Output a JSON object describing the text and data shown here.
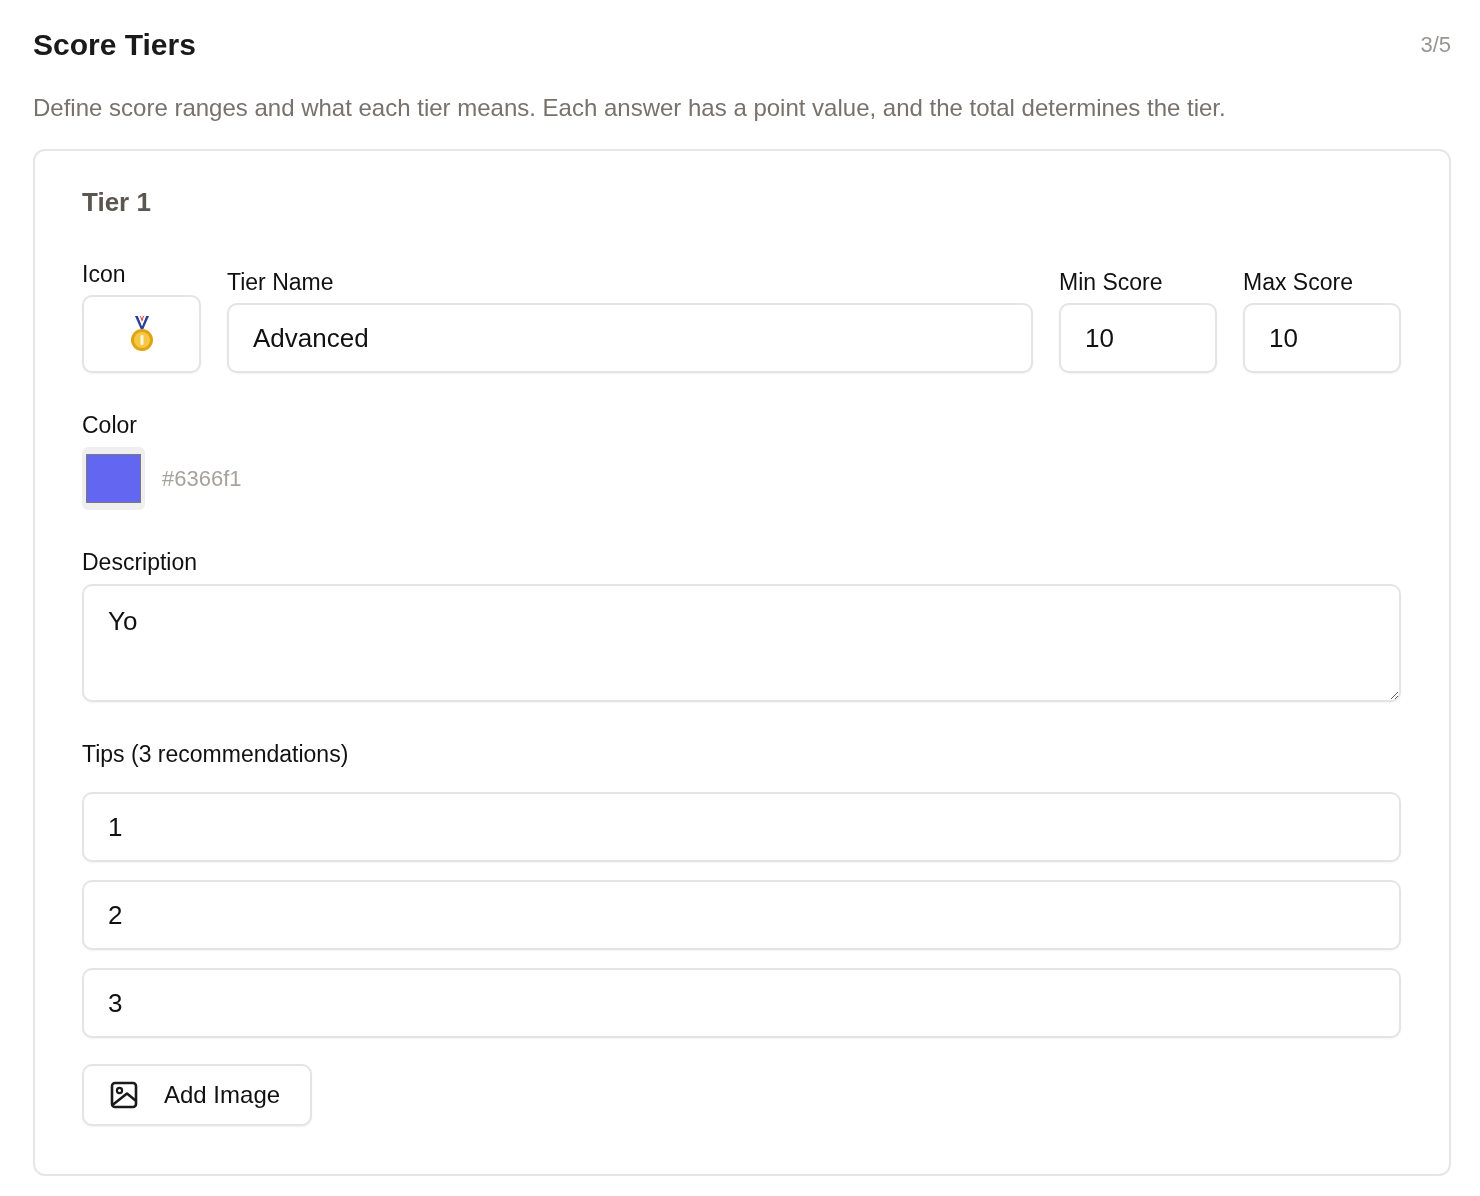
{
  "header": {
    "title": "Score Tiers",
    "step": "3/5",
    "description": "Define score ranges and what each tier means. Each answer has a point value, and the total determines the tier."
  },
  "tier": {
    "title": "Tier 1",
    "fields": [
      {
        "kind": "icon",
        "label": "Icon"
      },
      {
        "kind": "text",
        "label": "Tier Name",
        "value": "Advanced"
      },
      {
        "kind": "number",
        "label": "Min Score",
        "value": "10"
      },
      {
        "kind": "number",
        "label": "Max Score",
        "value": "10"
      }
    ],
    "color_field": {
      "label": "Color",
      "color": "#6366f1",
      "value": "#6366f1"
    },
    "description_field": {
      "label": "Description",
      "value": "Yo"
    },
    "tips": {
      "label": "Tips (3 recommendations)",
      "items": [
        {
          "value": "1"
        },
        {
          "value": "2"
        },
        {
          "value": "3"
        }
      ]
    },
    "add_image_button": {
      "label": "Add Image"
    }
  }
}
